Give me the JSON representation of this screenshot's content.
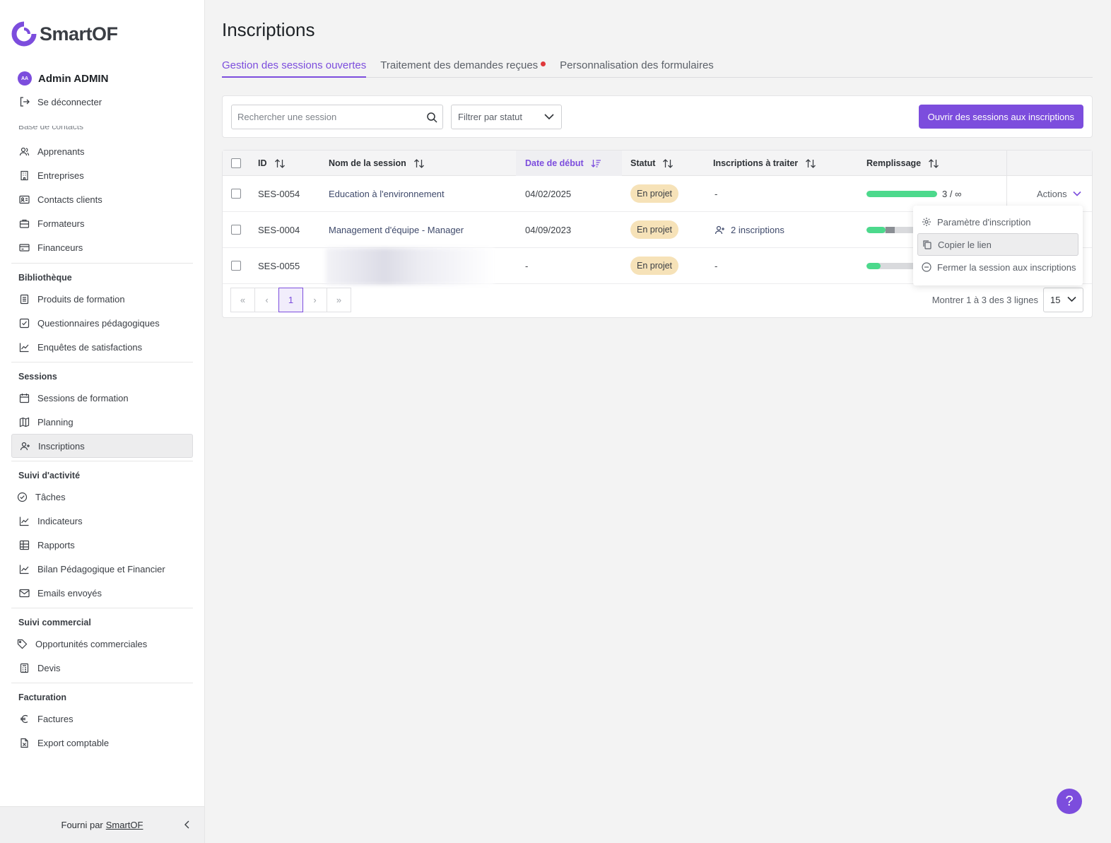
{
  "app": {
    "name": "SmartOF"
  },
  "user": {
    "initials": "AA",
    "name": "Admin ADMIN",
    "logout_label": "Se déconnecter"
  },
  "sidebar": {
    "clipped_section": "Base de contacts",
    "contacts": [
      "Apprenants",
      "Entreprises",
      "Contacts clients",
      "Formateurs",
      "Financeurs"
    ],
    "library_title": "Bibliothèque",
    "library": [
      "Produits de formation",
      "Questionnaires pédagogiques",
      "Enquêtes de satisfactions"
    ],
    "sessions_title": "Sessions",
    "sessions": [
      "Sessions de formation",
      "Planning",
      "Inscriptions"
    ],
    "activity_title": "Suivi d'activité",
    "activity": [
      "Tâches",
      "Indicateurs",
      "Rapports",
      "Bilan Pédagogique et Financier",
      "Emails envoyés"
    ],
    "commercial_title": "Suivi commercial",
    "commercial": [
      "Opportunités commerciales",
      "Devis"
    ],
    "billing_title": "Facturation",
    "billing": [
      "Factures",
      "Export comptable"
    ],
    "footer_text": "Fourni par",
    "footer_link": "SmartOF"
  },
  "page": {
    "title": "Inscriptions",
    "tabs": [
      "Gestion des sessions ouvertes",
      "Traitement des demandes reçues",
      "Personnalisation des formulaires"
    ],
    "search_placeholder": "Rechercher une session",
    "filter_placeholder": "Filtrer par statut",
    "primary_button": "Ouvrir des sessions aux inscriptions"
  },
  "table": {
    "headers": {
      "id": "ID",
      "name": "Nom de la session",
      "start": "Date de début",
      "status": "Statut",
      "pending": "Inscriptions à traiter",
      "fill": "Remplissage"
    },
    "rows": [
      {
        "id": "SES-0054",
        "name": "Education à l'environnement",
        "start": "04/02/2025",
        "status": "En projet",
        "pending": "-",
        "fill_text": "3 / ∞",
        "fill_ratio": 1.0
      },
      {
        "id": "SES-0004",
        "name": "Management d'équipe - Manager",
        "start": "04/09/2023",
        "status": "En projet",
        "pending": "2 inscriptions",
        "fill_ratio": 0.27,
        "fill_extra": 0.13
      },
      {
        "id": "SES-0055",
        "name": "",
        "start": "-",
        "status": "En projet",
        "pending": "-",
        "fill_ratio": 0.2
      }
    ],
    "actions_label": "Actions",
    "pagination": {
      "current": "1",
      "rows_info": "Montrer 1 à 3 des 3 lignes",
      "page_size": "15"
    }
  },
  "dropdown": {
    "items": [
      "Paramètre d'inscription",
      "Copier le lien",
      "Fermer la session aux inscriptions"
    ]
  },
  "colors": {
    "accent": "#7c4ddd",
    "badge": "#f6e2b8",
    "progress": "#4cd98c"
  }
}
